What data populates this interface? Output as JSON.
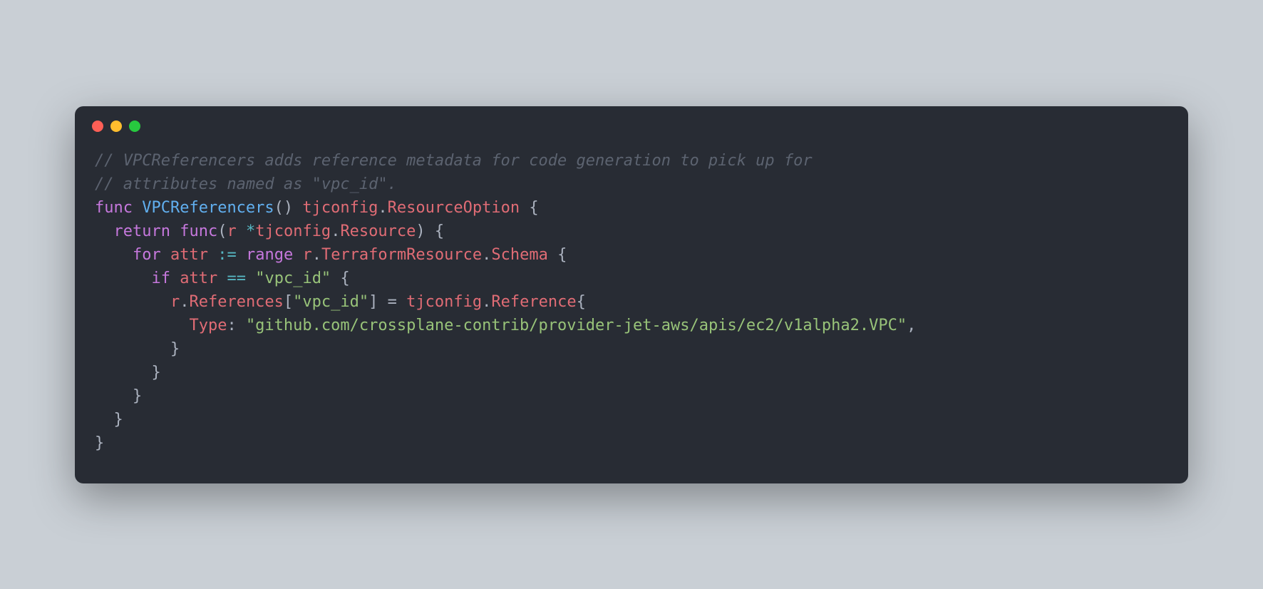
{
  "code": {
    "comment_line_1": "// VPCReferencers adds reference metadata for code generation to pick up for",
    "comment_line_2": "// attributes named as \"vpc_id\".",
    "kw_func": "func",
    "func_name": "VPCReferencers",
    "parens_open": "(",
    "parens_close": ")",
    "brace_open": "{",
    "brace_close": "}",
    "bracket_open": "[",
    "bracket_close": "]",
    "comma": ",",
    "dot": ".",
    "star": "*",
    "colon": ":",
    "ret_type_pkg": "tjconfig",
    "ret_type_name": "ResourceOption",
    "kw_return": "return",
    "kw_func_inner": "func",
    "param_r": "r",
    "inner_type_pkg": "tjconfig",
    "inner_type_name": "Resource",
    "kw_for": "for",
    "attr_ident": "attr",
    "walrus": ":=",
    "kw_range": "range",
    "r_var": "r",
    "tf_res": "TerraformResource",
    "schema": "Schema",
    "kw_if": "if",
    "eq_op": "==",
    "vpc_id_str": "\"vpc_id\"",
    "references": "References",
    "assign": "=",
    "ref_pkg": "tjconfig",
    "ref_type": "Reference",
    "type_field": "Type",
    "type_path_str": "\"github.com/crossplane-contrib/provider-jet-aws/apis/ec2/v1alpha2.VPC\"",
    "indent1": "  ",
    "indent2": "    ",
    "indent3": "      ",
    "indent4": "        ",
    "indent5": "          ",
    "indent6": "            "
  }
}
